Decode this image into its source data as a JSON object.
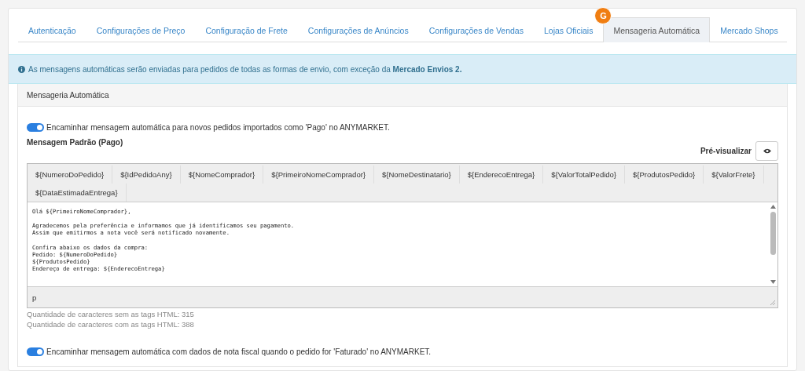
{
  "tabs": [
    {
      "label": "Autenticação",
      "selected": false
    },
    {
      "label": "Configurações de Preço",
      "selected": false
    },
    {
      "label": "Configuração de Frete",
      "selected": false
    },
    {
      "label": "Configurações de Anúncios",
      "selected": false
    },
    {
      "label": "Configurações de Vendas",
      "selected": false
    },
    {
      "label": "Lojas Oficiais",
      "selected": false
    },
    {
      "label": "Mensageria Automática",
      "selected": true
    },
    {
      "label": "Mercado Shops",
      "selected": false
    }
  ],
  "badge": "G",
  "alert": "As mensagens automáticas serão enviadas para pedidos de todas as formas de envio, com exceção da **Mercado Envios 2.**",
  "panel": {
    "title": "Mensageria Automática",
    "toggle_1": {
      "label": "Encaminhar mensagem automática para novos pedidos importados como 'Pago' no ANYMARKET.",
      "on": true
    },
    "message_label": "Mensagem Padrão (Pago)",
    "preview_label": "Pré-visualizar",
    "tags": [
      "${NumeroDoPedido}",
      "${IdPedidoAny}",
      "${NomeComprador}",
      "${PrimeiroNomeComprador}",
      "${NomeDestinatario}",
      "${EnderecoEntrega}",
      "${ValorTotalPedido}",
      "${ProdutosPedido}",
      "${ValorFrete}",
      "${DataEstimadaEntrega}"
    ],
    "editor_paragraphs": [
      [
        "Olá ${PrimeiroNomeComprador},"
      ],
      [
        "Agradecemos pela preferência e informamos que já identificamos seu pagamento.",
        "Assim que emitirmos a nota você será notificado novamente."
      ],
      [
        "Confira abaixo os dados da compra:",
        "Pedido: ${NumeroDoPedido}",
        "${ProdutosPedido}",
        "Endereço de entrega: ${EnderecoEntrega}"
      ]
    ],
    "editor_status": "p",
    "counts": [
      "Quantidade de caracteres sem as tags HTML: 315",
      "Quantidade de caracteres com as tags HTML: 388"
    ],
    "toggle_2": {
      "label": "Encaminhar mensagem automática com dados de nota fiscal quando o pedido for 'Faturado' no ANYMARKET.",
      "on": true
    }
  }
}
